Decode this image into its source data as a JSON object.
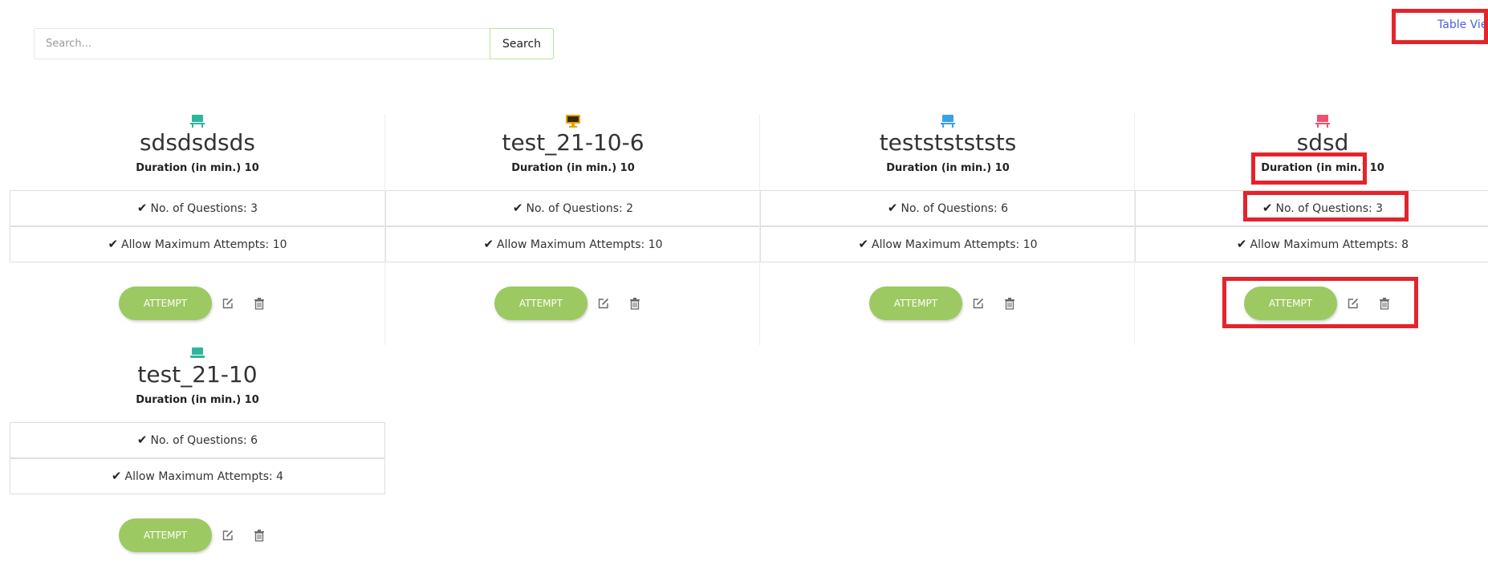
{
  "search": {
    "placeholder": "Search...",
    "button_label": "Search"
  },
  "view_toggle": {
    "label": "Table View"
  },
  "colors": {
    "attempt_button": "#9dc962",
    "highlight": "#e4242c",
    "link": "#4b63d6"
  },
  "cards": [
    {
      "title": "sdsdsdsds",
      "duration": "Duration (in min.) 10",
      "questions": "No. of Questions: 3",
      "attempts": "Allow Maximum Attempts: 10",
      "attempt_label": "ATTEMPT",
      "icon": "desk-icon",
      "icon_color": "#2bb79b"
    },
    {
      "title": "test_21-10-6",
      "duration": "Duration (in min.) 10",
      "questions": "No. of Questions: 2",
      "attempts": "Allow Maximum Attempts: 10",
      "attempt_label": "ATTEMPT",
      "icon": "monitor-icon",
      "icon_color": "#e8a200"
    },
    {
      "title": "testststststs",
      "duration": "Duration (in min.) 10",
      "questions": "No. of Questions: 6",
      "attempts": "Allow Maximum Attempts: 10",
      "attempt_label": "ATTEMPT",
      "icon": "desk-icon",
      "icon_color": "#3aa0e8"
    },
    {
      "title": "sdsd",
      "duration": "Duration (in min.) 10",
      "questions": "No. of Questions: 3",
      "attempts": "Allow Maximum Attempts: 8",
      "attempt_label": "ATTEMPT",
      "icon": "desk-icon",
      "icon_color": "#f0506e"
    },
    {
      "title": "test_21-10",
      "duration": "Duration (in min.) 10",
      "questions": "No. of Questions: 6",
      "attempts": "Allow Maximum Attempts: 4",
      "attempt_label": "ATTEMPT",
      "icon": "laptop-icon",
      "icon_color": "#2bb79b"
    }
  ]
}
